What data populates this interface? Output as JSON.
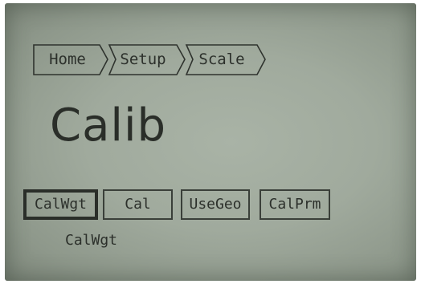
{
  "breadcrumb": {
    "items": [
      {
        "label": "Home"
      },
      {
        "label": "Setup"
      },
      {
        "label": "Scale"
      }
    ]
  },
  "title": "Calib",
  "softkeys": [
    {
      "label": "CalWgt",
      "selected": true
    },
    {
      "label": "Cal",
      "selected": false
    },
    {
      "label": "UseGeo",
      "selected": false
    },
    {
      "label": "CalPrm",
      "selected": false
    }
  ],
  "selected_label": "CalWgt",
  "colors": {
    "lcd_background": "#a0aa9d",
    "lcd_text": "#2c302b"
  }
}
